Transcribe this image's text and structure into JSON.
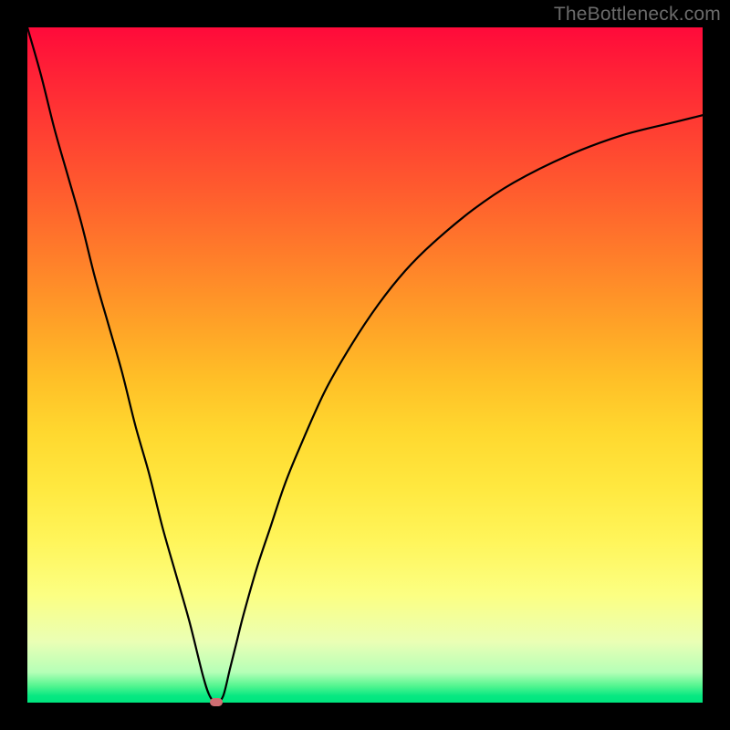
{
  "watermark": "TheBottleneck.com",
  "colors": {
    "frame": "#000000",
    "curve": "#000000",
    "marker": "#cf6d72"
  },
  "chart_data": {
    "type": "line",
    "title": "",
    "xlabel": "",
    "ylabel": "",
    "xlim": [
      0,
      100
    ],
    "ylim": [
      0,
      100
    ],
    "grid": false,
    "legend": false,
    "background": "rainbow-gradient (red top → green bottom)",
    "annotations": [
      {
        "text": "TheBottleneck.com",
        "pos": "top-right"
      }
    ],
    "series": [
      {
        "name": "bottleneck-curve",
        "color": "#000000",
        "x": [
          0,
          2,
          4,
          6,
          8,
          10,
          12,
          14,
          16,
          18,
          20,
          22,
          24,
          26,
          27,
          28,
          29,
          30,
          31,
          32,
          34,
          36,
          38,
          40,
          44,
          48,
          52,
          56,
          60,
          66,
          72,
          80,
          88,
          96,
          100
        ],
        "y": [
          100,
          93,
          85,
          78,
          71,
          63,
          56,
          49,
          41,
          34,
          26,
          19,
          12,
          4,
          1,
          0,
          1,
          5,
          9,
          13,
          20,
          26,
          32,
          37,
          46,
          53,
          59,
          64,
          68,
          73,
          77,
          81,
          84,
          86,
          87
        ]
      }
    ],
    "min_point": {
      "x": 28,
      "y": 0
    }
  }
}
